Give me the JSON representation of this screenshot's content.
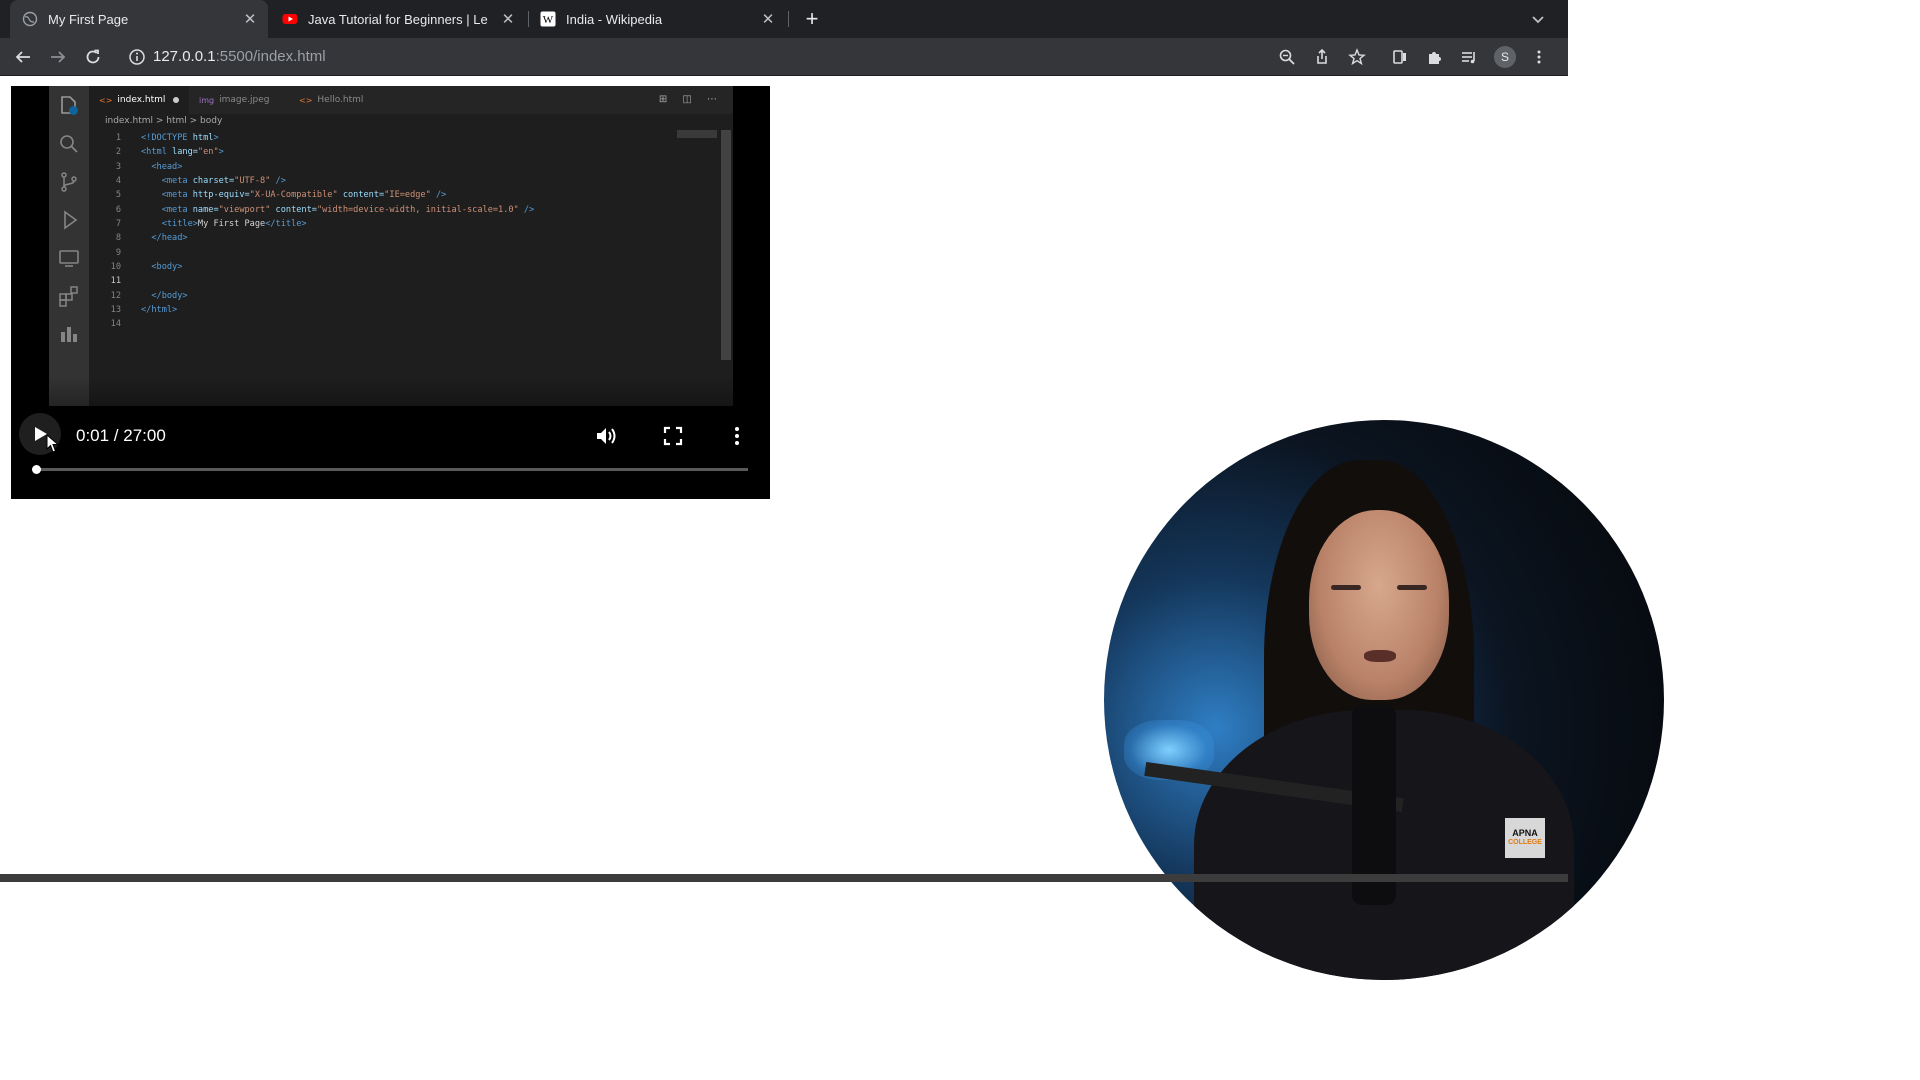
{
  "browser": {
    "tabs": [
      {
        "title": "My First Page",
        "icon": "globe-icon",
        "active": true
      },
      {
        "title": "Java Tutorial for Beginners | Le",
        "icon": "youtube-icon",
        "active": false
      },
      {
        "title": "India - Wikipedia",
        "icon": "wikipedia-icon",
        "active": false
      }
    ],
    "new_tab_label": "+",
    "close_glyph": "✕",
    "url_host": "127.0.0.1",
    "url_rest": ":5500/index.html",
    "profile_initial": "S"
  },
  "video": {
    "editor": {
      "tabs": [
        {
          "label": "index.html",
          "type": "<>",
          "active": true,
          "modified": true
        },
        {
          "label": "image.jpeg",
          "type": "img",
          "active": false
        },
        {
          "label": "Hello.html",
          "type": "<>",
          "active": false
        }
      ],
      "actions": "⊞ ◫ ⋯",
      "breadcrumb": "index.html  >  html  >  body",
      "current_line": 11,
      "lines": [
        {
          "n": "1",
          "indent": "",
          "parts": [
            [
              "tag",
              "<!DOCTYPE "
            ],
            [
              "attr",
              "html"
            ],
            [
              "tag",
              ">"
            ]
          ]
        },
        {
          "n": "2",
          "indent": "",
          "parts": [
            [
              "tag",
              "<html "
            ],
            [
              "attr",
              "lang="
            ],
            [
              "str",
              "\"en\""
            ],
            [
              "tag",
              ">"
            ]
          ]
        },
        {
          "n": "3",
          "indent": "  ",
          "parts": [
            [
              "tag",
              "<head>"
            ]
          ]
        },
        {
          "n": "4",
          "indent": "    ",
          "parts": [
            [
              "tag",
              "<meta "
            ],
            [
              "attr",
              "charset="
            ],
            [
              "str",
              "\"UTF-8\""
            ],
            [
              "tag",
              " />"
            ]
          ]
        },
        {
          "n": "5",
          "indent": "    ",
          "parts": [
            [
              "tag",
              "<meta "
            ],
            [
              "attr",
              "http-equiv="
            ],
            [
              "str",
              "\"X-UA-Compatible\""
            ],
            [
              "attr",
              " content="
            ],
            [
              "str",
              "\"IE=edge\""
            ],
            [
              "tag",
              " />"
            ]
          ]
        },
        {
          "n": "6",
          "indent": "    ",
          "parts": [
            [
              "tag",
              "<meta "
            ],
            [
              "attr",
              "name="
            ],
            [
              "str",
              "\"viewport\""
            ],
            [
              "attr",
              " content="
            ],
            [
              "str",
              "\"width=device-width, initial-scale=1.0\""
            ],
            [
              "tag",
              " />"
            ]
          ]
        },
        {
          "n": "7",
          "indent": "    ",
          "parts": [
            [
              "tag",
              "<title>"
            ],
            [
              "txt",
              "My First Page"
            ],
            [
              "tag",
              "</title>"
            ]
          ]
        },
        {
          "n": "8",
          "indent": "  ",
          "parts": [
            [
              "tag",
              "</head>"
            ]
          ]
        },
        {
          "n": "9",
          "indent": "",
          "parts": []
        },
        {
          "n": "10",
          "indent": "  ",
          "parts": [
            [
              "tag",
              "<body>"
            ]
          ]
        },
        {
          "n": "11",
          "indent": "",
          "parts": []
        },
        {
          "n": "12",
          "indent": "  ",
          "parts": [
            [
              "tag",
              "</body>"
            ]
          ]
        },
        {
          "n": "13",
          "indent": "",
          "parts": [
            [
              "tag",
              "</html>"
            ]
          ]
        },
        {
          "n": "14",
          "indent": "",
          "parts": []
        }
      ]
    },
    "time_display": "0:01 / 27:00",
    "progress": 0.0006
  },
  "logo": {
    "line1": "APNA",
    "line2": "COLLEGE"
  }
}
